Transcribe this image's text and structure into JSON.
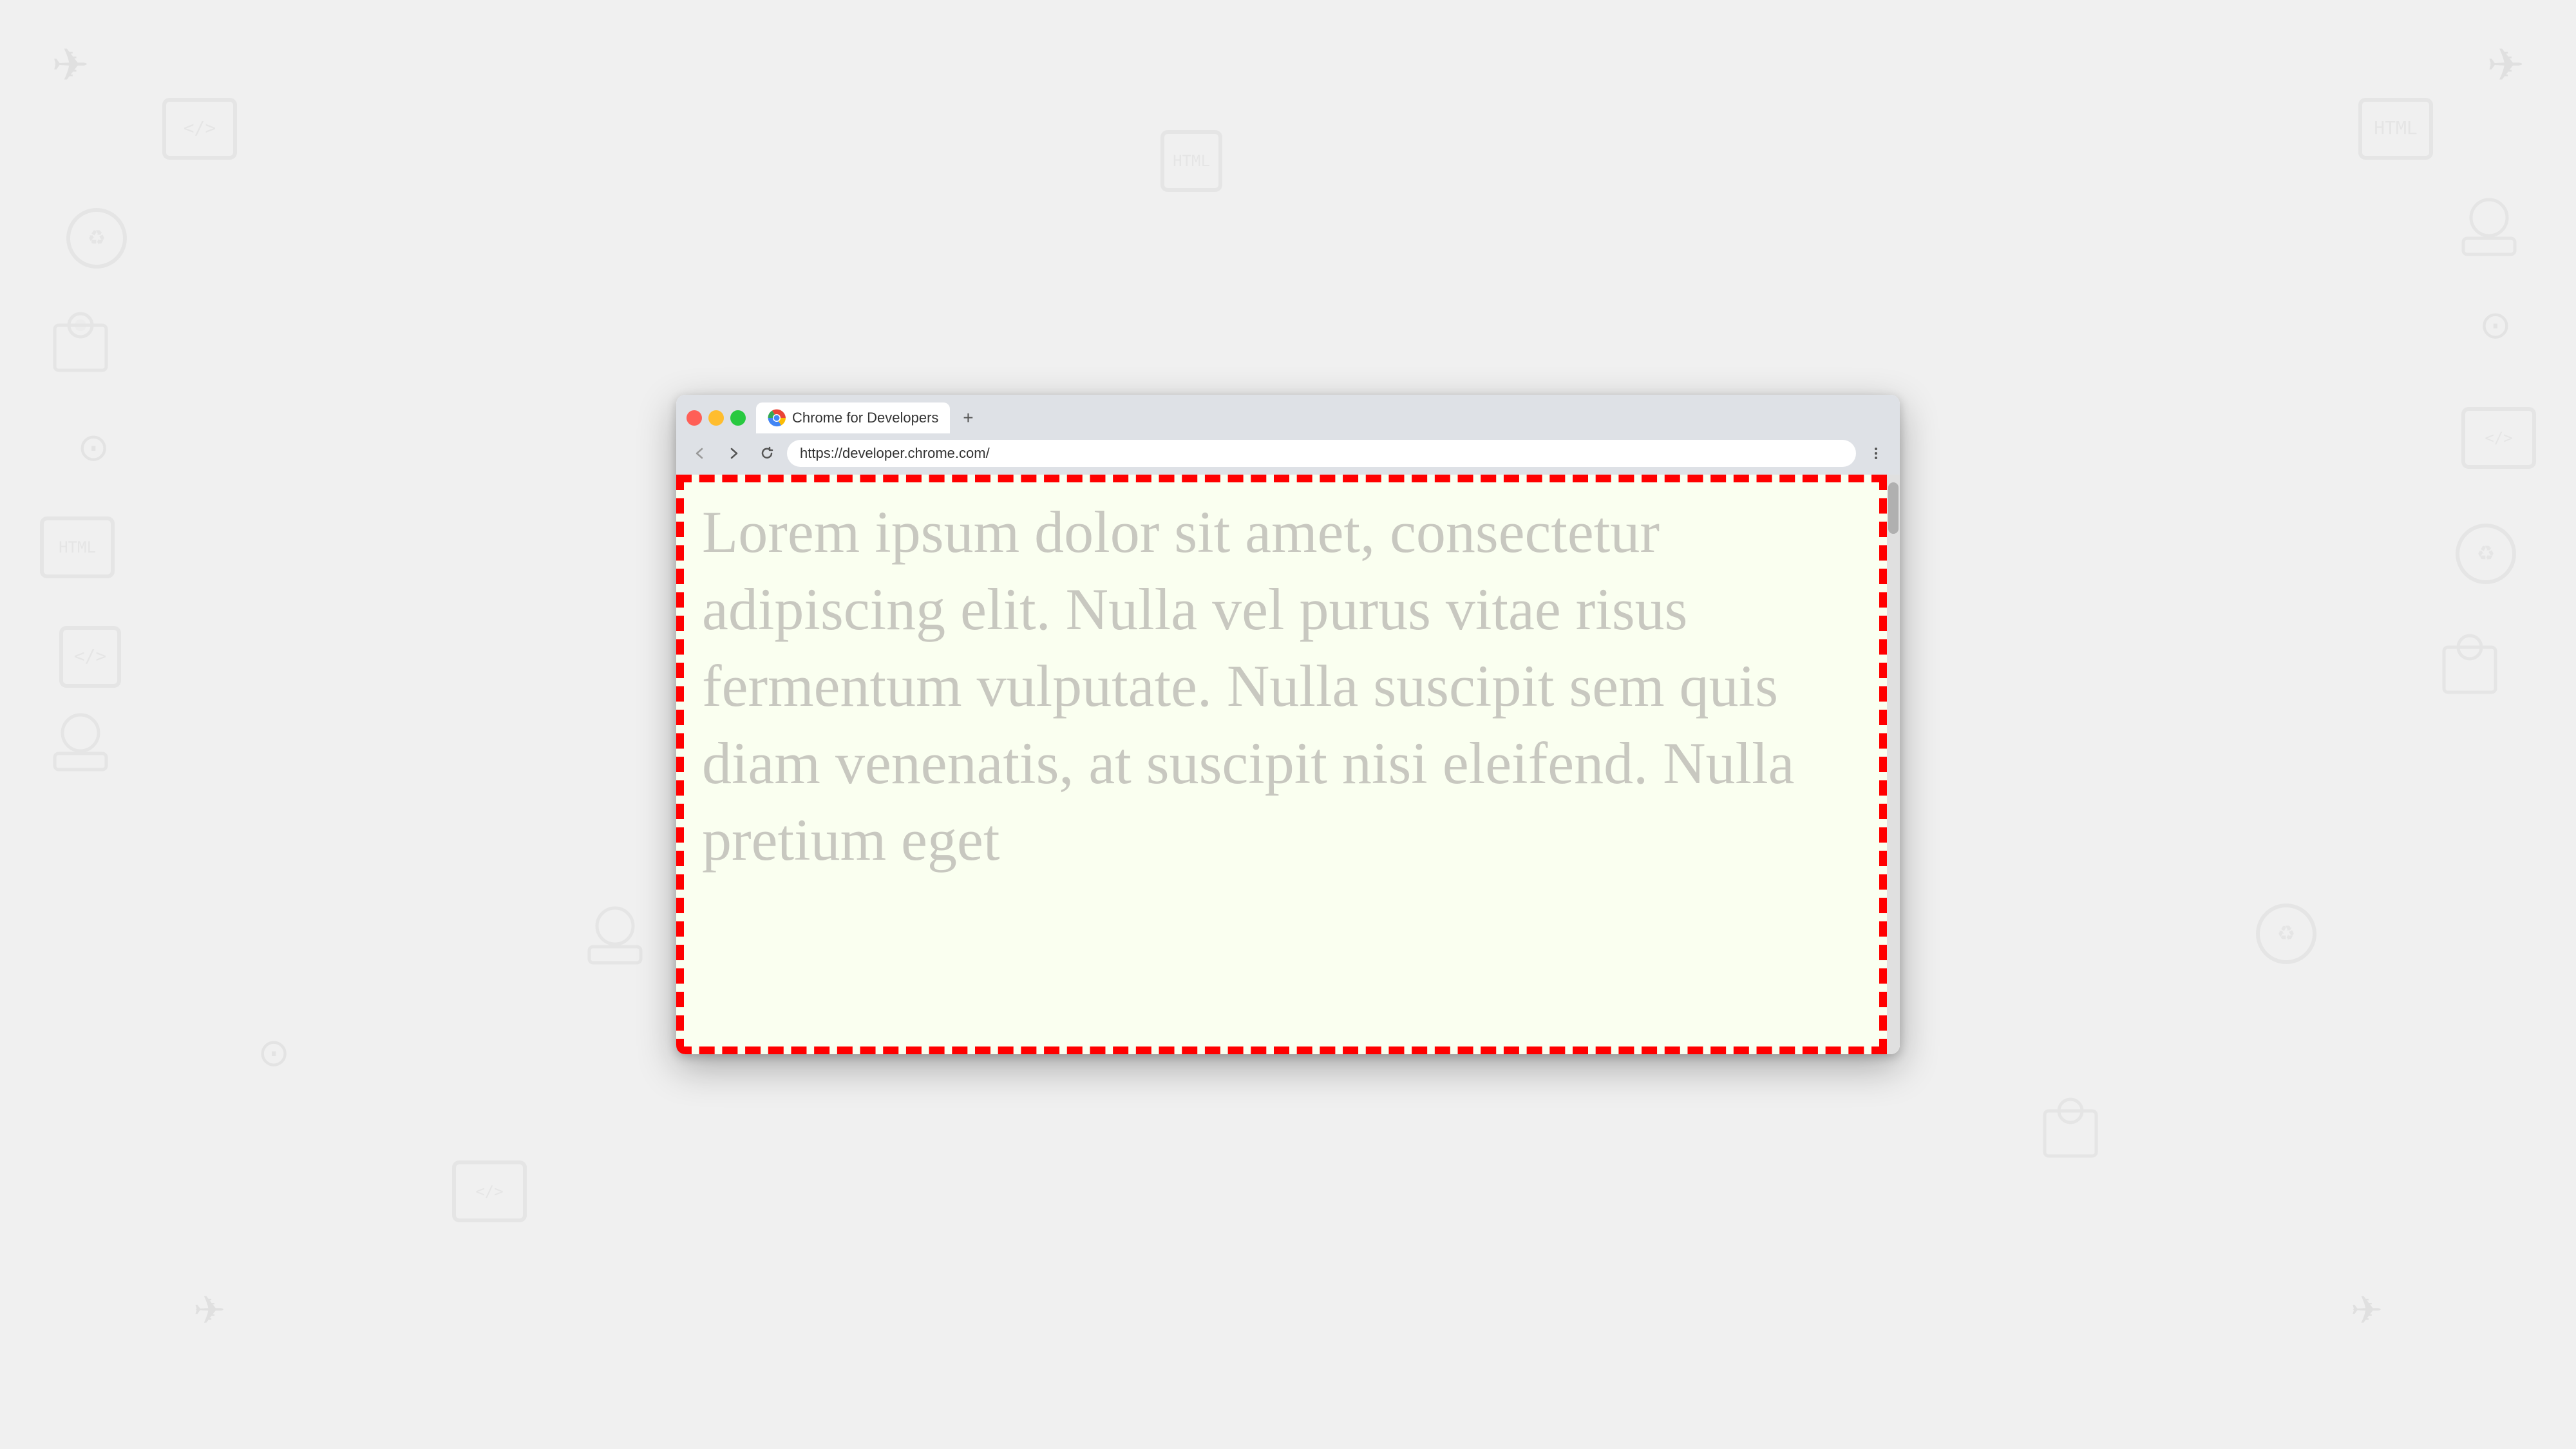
{
  "background": {
    "color": "#efefef"
  },
  "browser": {
    "tab": {
      "title": "Chrome for Developers",
      "favicon_alt": "Chrome logo"
    },
    "new_tab_label": "+",
    "address_bar": {
      "url": "https://developer.chrome.com/"
    },
    "nav": {
      "back_label": "←",
      "forward_label": "→",
      "reload_label": "↺",
      "menu_label": "⋮"
    },
    "content": {
      "lorem_text": "Lorem ipsum dolor sit amet, consectetur adipiscing elit. Nulla vel purus vitae risus fermentum vulputate. Nulla suscipit sem quis diam venenatis, at suscipit nisi eleifend. Nulla pretium eget"
    }
  }
}
